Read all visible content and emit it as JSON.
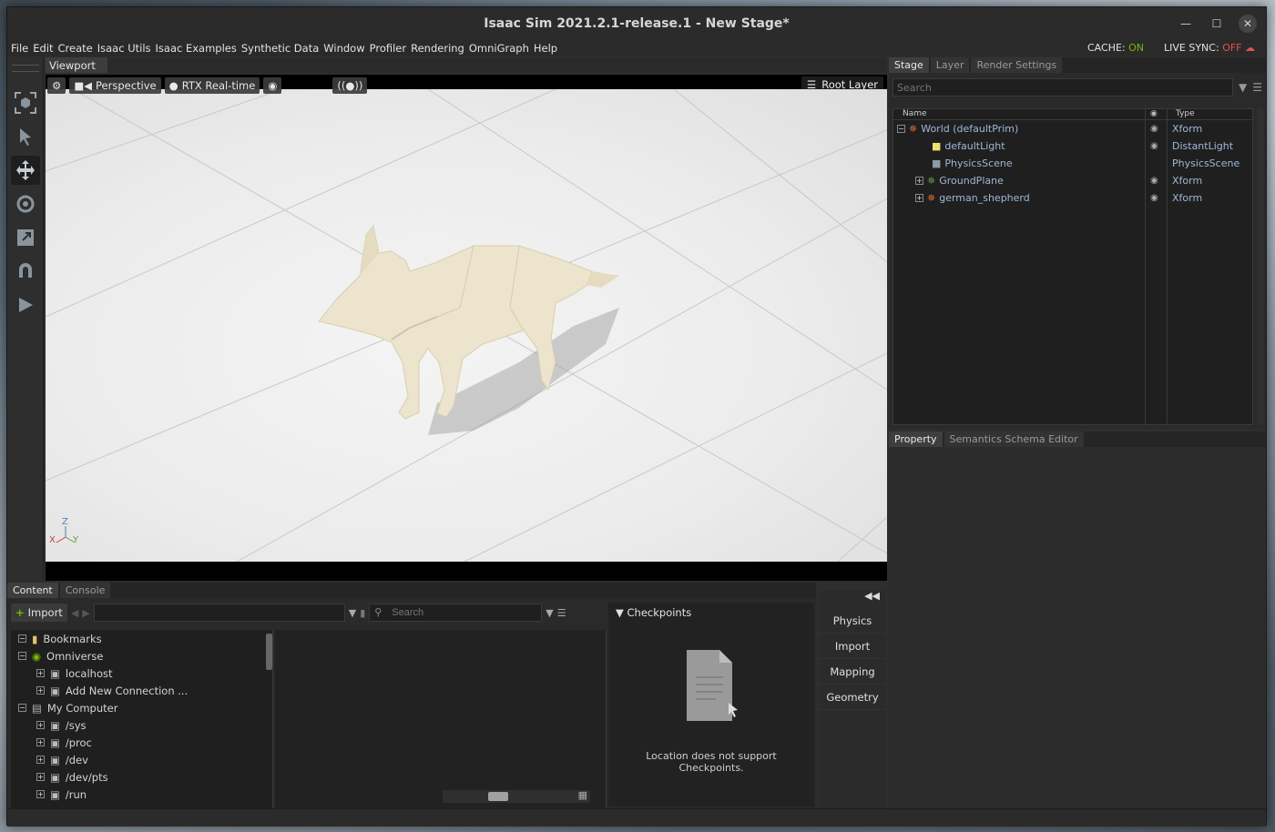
{
  "window": {
    "title": "Isaac Sim 2021.2.1-release.1 - New Stage*"
  },
  "menu": {
    "items": [
      "File",
      "Edit",
      "Create",
      "Isaac Utils",
      "Isaac Examples",
      "Synthetic Data",
      "Window",
      "Profiler",
      "Rendering",
      "OmniGraph",
      "Help"
    ],
    "cache_label": "CACHE:",
    "cache_value": "ON",
    "livesync_label": "LIVE SYNC:",
    "livesync_value": "OFF"
  },
  "viewport": {
    "tab_label": "Viewport",
    "camera_label": "Perspective",
    "render_label": "RTX Real-time",
    "root_layer_label": "Root Layer",
    "axis_z": "Z",
    "axis_x": "X",
    "axis_y": "Y"
  },
  "stage": {
    "tabs": [
      "Stage",
      "Layer",
      "Render Settings"
    ],
    "search_placeholder": "Search",
    "col_name": "Name",
    "col_type": "Type",
    "items": [
      {
        "name": "World (defaultPrim)",
        "type": "Xform"
      },
      {
        "name": "defaultLight",
        "type": "DistantLight"
      },
      {
        "name": "PhysicsScene",
        "type": "PhysicsScene"
      },
      {
        "name": "GroundPlane",
        "type": "Xform"
      },
      {
        "name": "german_shepherd",
        "type": "Xform"
      }
    ]
  },
  "property": {
    "tabs": [
      "Property",
      "Semantics Schema Editor"
    ]
  },
  "content": {
    "tabs": [
      "Content",
      "Console"
    ],
    "import_label": "Import",
    "search_placeholder": "Search",
    "tree": [
      {
        "label": "Bookmarks"
      },
      {
        "label": "Omniverse"
      },
      {
        "label": "localhost"
      },
      {
        "label": "Add New Connection ..."
      },
      {
        "label": "My Computer"
      },
      {
        "label": "/sys"
      },
      {
        "label": "/proc"
      },
      {
        "label": "/dev"
      },
      {
        "label": "/dev/pts"
      },
      {
        "label": "/run"
      }
    ],
    "checkpoints_title": "Checkpoints",
    "checkpoints_message": "Location does not support Checkpoints."
  },
  "side_panel": {
    "buttons": [
      "Physics",
      "Import",
      "Mapping",
      "Geometry"
    ]
  },
  "colors": {
    "accent_on": "#76b900",
    "accent_off": "#e05050",
    "tree_text": "#9fb8d6"
  }
}
